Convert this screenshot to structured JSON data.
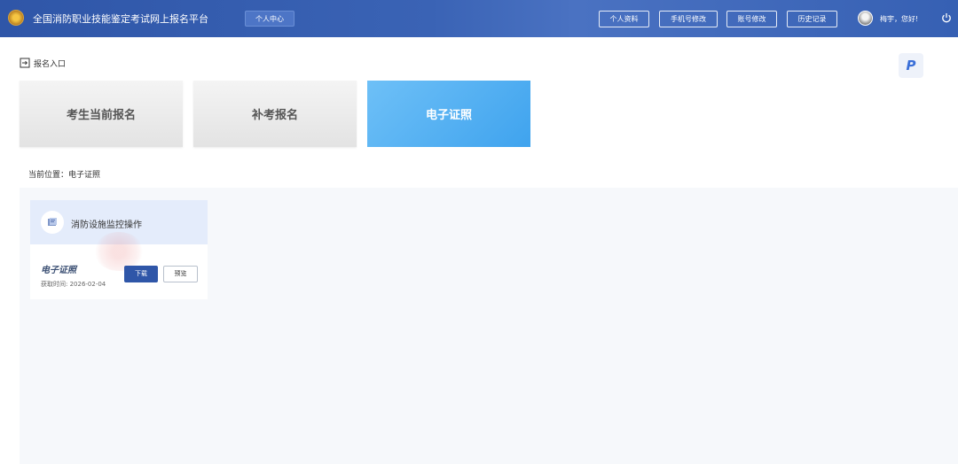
{
  "header": {
    "title": "全国消防职业技能鉴定考试网上报名平台",
    "center_button": "个人中心",
    "buttons": [
      "个人资料",
      "手机号修改",
      "账号修改",
      "历史记录"
    ],
    "greeting": "梅宇，您好!"
  },
  "entry": {
    "label": "报名入口"
  },
  "badge": {
    "letter": "P"
  },
  "tiles": [
    "考生当前报名",
    "补考报名",
    "电子证照"
  ],
  "location": {
    "text": "当前位置：电子证照"
  },
  "card": {
    "name": "消防设施监控操作",
    "cert_label": "电子证照",
    "obtained": "获取时间: 2026-02-04",
    "download_label": "下载",
    "preview_label": "预览"
  },
  "colors": {
    "header": "#2f56a8",
    "accent": "#3fa3ee",
    "primary_button": "#2f56a8"
  },
  "icons": [
    "logo-emblem",
    "entry-icon",
    "avatar",
    "power-icon",
    "certificate-icon"
  ]
}
